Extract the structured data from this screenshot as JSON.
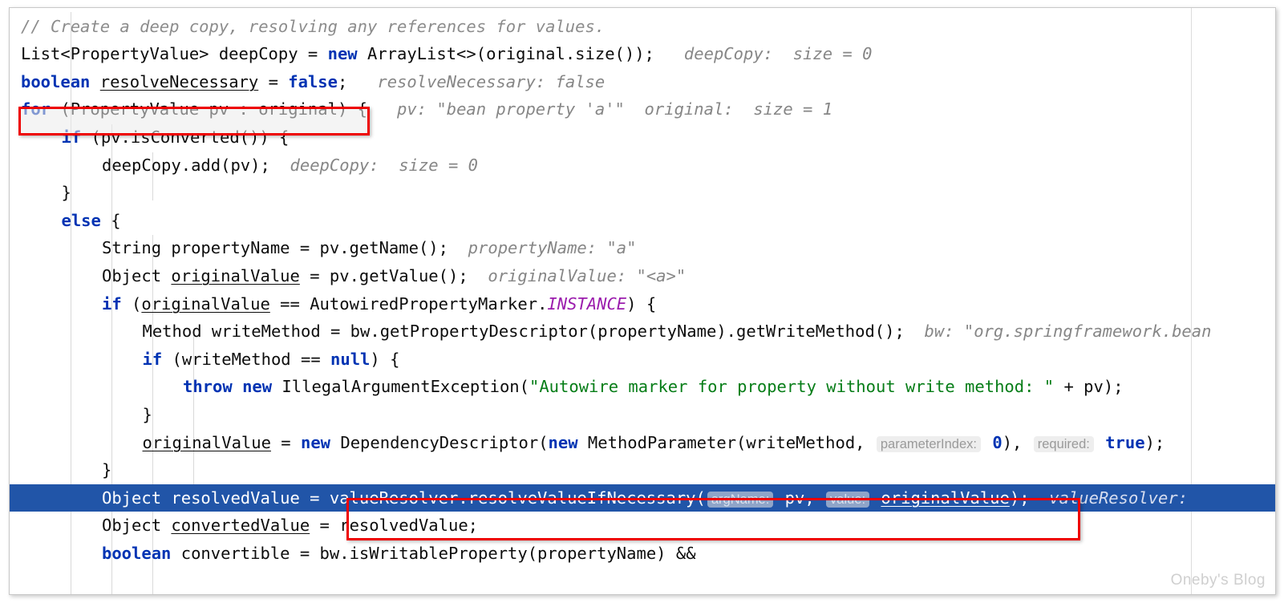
{
  "editor": {
    "language": "java",
    "watermark": "Oneby's Blog",
    "theme": {
      "background": "#ffffff",
      "keyword_color": "#0033b3",
      "string_color": "#067d17",
      "comment_color": "#8c8c8c",
      "static_field_color": "#9b1cad",
      "inline_hint_color": "#868686",
      "execution_line_background": "#2155a8",
      "execution_line_text": "#ffffff",
      "annotation_color": "#ee0000"
    },
    "lines": [
      {
        "n": 1,
        "indent": 0,
        "segments": [
          {
            "t": "// Create a deep copy, resolving any references for values.",
            "c": "cmt"
          }
        ]
      },
      {
        "n": 2,
        "indent": 0,
        "segments": [
          {
            "t": "List<PropertyValue> deepCopy = ",
            "c": ""
          },
          {
            "t": "new",
            "c": "kw"
          },
          {
            "t": " ArrayList<>(original.size());",
            "c": ""
          },
          {
            "t": "   deepCopy:  size = 0",
            "c": "hint"
          }
        ]
      },
      {
        "n": 3,
        "indent": 0,
        "segments": [
          {
            "t": "boolean",
            "c": "kw"
          },
          {
            "t": " ",
            "c": ""
          },
          {
            "t": "resolveNecessary",
            "c": "fld"
          },
          {
            "t": " = ",
            "c": ""
          },
          {
            "t": "false",
            "c": "kw"
          },
          {
            "t": ";",
            "c": ""
          },
          {
            "t": "   resolveNecessary: false",
            "c": "hint"
          }
        ]
      },
      {
        "n": 4,
        "indent": 0,
        "segments": [
          {
            "t": "for",
            "c": "kw"
          },
          {
            "t": " (PropertyValue pv : original) {",
            "c": ""
          },
          {
            "t": "   pv: \"bean property 'a'\"  original:  size = 1",
            "c": "hint"
          }
        ]
      },
      {
        "n": 5,
        "indent": 1,
        "segments": [
          {
            "t": "if",
            "c": "kw"
          },
          {
            "t": " (pv.isConverted()) {",
            "c": ""
          }
        ]
      },
      {
        "n": 6,
        "indent": 2,
        "segments": [
          {
            "t": "deepCopy.add(pv);",
            "c": ""
          },
          {
            "t": "  deepCopy:  size = 0",
            "c": "hint"
          }
        ]
      },
      {
        "n": 7,
        "indent": 1,
        "segments": [
          {
            "t": "}",
            "c": ""
          }
        ]
      },
      {
        "n": 8,
        "indent": 1,
        "segments": [
          {
            "t": "else",
            "c": "kw"
          },
          {
            "t": " {",
            "c": ""
          }
        ]
      },
      {
        "n": 9,
        "indent": 2,
        "segments": [
          {
            "t": "String propertyName = pv.getName();",
            "c": ""
          },
          {
            "t": "  propertyName: \"a\"",
            "c": "hint"
          }
        ]
      },
      {
        "n": 10,
        "indent": 2,
        "segments": [
          {
            "t": "Object ",
            "c": ""
          },
          {
            "t": "originalValue",
            "c": "fld"
          },
          {
            "t": " = pv.getValue();",
            "c": ""
          },
          {
            "t": "  originalValue: \"<a>\"",
            "c": "hint"
          }
        ]
      },
      {
        "n": 11,
        "indent": 2,
        "segments": [
          {
            "t": "if",
            "c": "kw"
          },
          {
            "t": " (",
            "c": ""
          },
          {
            "t": "originalValue",
            "c": "fld"
          },
          {
            "t": " == AutowiredPropertyMarker.",
            "c": ""
          },
          {
            "t": "INSTANCE",
            "c": "stat"
          },
          {
            "t": ") {",
            "c": ""
          }
        ]
      },
      {
        "n": 12,
        "indent": 3,
        "segments": [
          {
            "t": "Method writeMethod = bw.getPropertyDescriptor(propertyName).getWriteMethod();",
            "c": ""
          },
          {
            "t": "  bw: \"org.springframework.bean",
            "c": "hint"
          }
        ]
      },
      {
        "n": 13,
        "indent": 3,
        "segments": [
          {
            "t": "if",
            "c": "kw"
          },
          {
            "t": " (writeMethod == ",
            "c": ""
          },
          {
            "t": "null",
            "c": "kw"
          },
          {
            "t": ") {",
            "c": ""
          }
        ]
      },
      {
        "n": 14,
        "indent": 4,
        "segments": [
          {
            "t": "throw",
            "c": "kw"
          },
          {
            "t": " ",
            "c": ""
          },
          {
            "t": "new",
            "c": "kw"
          },
          {
            "t": " IllegalArgumentException(",
            "c": ""
          },
          {
            "t": "\"Autowire marker for property without write method: \"",
            "c": "str"
          },
          {
            "t": " + pv);",
            "c": ""
          }
        ]
      },
      {
        "n": 15,
        "indent": 3,
        "segments": [
          {
            "t": "}",
            "c": ""
          }
        ]
      },
      {
        "n": 16,
        "indent": 3,
        "segments": [
          {
            "t": "originalValue",
            "c": "fld"
          },
          {
            "t": " = ",
            "c": ""
          },
          {
            "t": "new",
            "c": "kw"
          },
          {
            "t": " DependencyDescriptor(",
            "c": ""
          },
          {
            "t": "new",
            "c": "kw"
          },
          {
            "t": " MethodParameter(writeMethod, ",
            "c": ""
          },
          {
            "t": "parameterIndex:",
            "c": "chip"
          },
          {
            "t": " ",
            "c": ""
          },
          {
            "t": "0",
            "c": "kw"
          },
          {
            "t": "), ",
            "c": ""
          },
          {
            "t": "required:",
            "c": "chip"
          },
          {
            "t": " ",
            "c": ""
          },
          {
            "t": "true",
            "c": "kw"
          },
          {
            "t": ");",
            "c": ""
          }
        ]
      },
      {
        "n": 17,
        "indent": 2,
        "segments": [
          {
            "t": "}",
            "c": ""
          }
        ]
      },
      {
        "n": 18,
        "indent": 2,
        "execution": true,
        "segments": [
          {
            "t": "Object resolvedValue = valueResolver.resolveValueIfNecessary(",
            "c": ""
          },
          {
            "t": "argName:",
            "c": "chip"
          },
          {
            "t": " pv, ",
            "c": ""
          },
          {
            "t": "value:",
            "c": "chip"
          },
          {
            "t": " ",
            "c": ""
          },
          {
            "t": "originalValue",
            "c": "fld"
          },
          {
            "t": ");",
            "c": ""
          },
          {
            "t": "  valueResolver:",
            "c": "hint"
          }
        ]
      },
      {
        "n": 19,
        "indent": 2,
        "segments": [
          {
            "t": "Object ",
            "c": ""
          },
          {
            "t": "convertedValue",
            "c": "fld"
          },
          {
            "t": " = resolvedValue;",
            "c": ""
          }
        ]
      },
      {
        "n": 20,
        "indent": 2,
        "segments": [
          {
            "t": "boolean",
            "c": "kw"
          },
          {
            "t": " convertible = bw.isWritableProperty(propertyName) &&",
            "c": ""
          }
        ]
      }
    ],
    "annotations": [
      {
        "name": "for-loop-highlight",
        "target": "for (PropertyValue pv : original)"
      },
      {
        "name": "resolve-call-highlight",
        "target": "valueResolver.resolveValueIfNecessary( argName: pv, value: originalValue);"
      }
    ]
  }
}
